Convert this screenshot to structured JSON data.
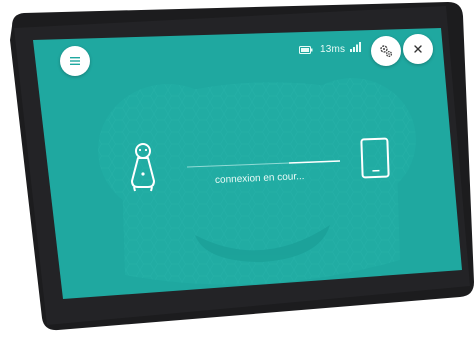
{
  "status": {
    "ping": "13ms"
  },
  "connection": {
    "message": "connexion en cour..."
  },
  "colors": {
    "screen": "#1fa8a0",
    "frame": "#1c1c1e",
    "accent": "#ffffff"
  },
  "icons": {
    "menu": "menu-icon",
    "settings": "gear-icon",
    "close": "close-icon",
    "battery": "battery-icon",
    "signal": "signal-icon",
    "robot": "robot-icon",
    "tablet": "tablet-icon"
  }
}
